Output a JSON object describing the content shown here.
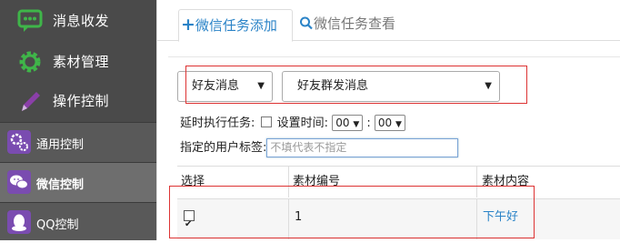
{
  "sidebar": {
    "main_items": [
      {
        "label": "消息收发",
        "icon": "chat-bubble-icon"
      },
      {
        "label": "素材管理",
        "icon": "gear-icon"
      },
      {
        "label": "操作控制",
        "icon": "pen-icon"
      }
    ],
    "sub_items": [
      {
        "label": "通用控制",
        "icon": "cogs-icon",
        "active": false
      },
      {
        "label": "微信控制",
        "icon": "wechat-icon",
        "active": true
      },
      {
        "label": "QQ控制",
        "icon": "qq-icon",
        "active": false
      }
    ]
  },
  "tabs": {
    "add_label": "微信任务添加",
    "view_label": "微信任务查看"
  },
  "filters": {
    "friend_select_value": "好友消息",
    "type_select_value": "好友群发消息"
  },
  "delay": {
    "label": "延时执行任务:",
    "set_time_label": "设置时间:",
    "hour_value": "00",
    "minute_value": "00"
  },
  "tag": {
    "label": "指定的用户标签:",
    "placeholder": "不填代表不指定"
  },
  "table": {
    "headers": [
      "选择",
      "素材编号",
      "素材内容"
    ],
    "rows": [
      {
        "checked": true,
        "id": "1",
        "content": "下午好"
      }
    ]
  },
  "colors": {
    "sidebar_bg": "#4a4a4a",
    "accent_green": "#3fb549",
    "link_blue": "#2a83c7",
    "highlight_red": "#dd3333"
  }
}
